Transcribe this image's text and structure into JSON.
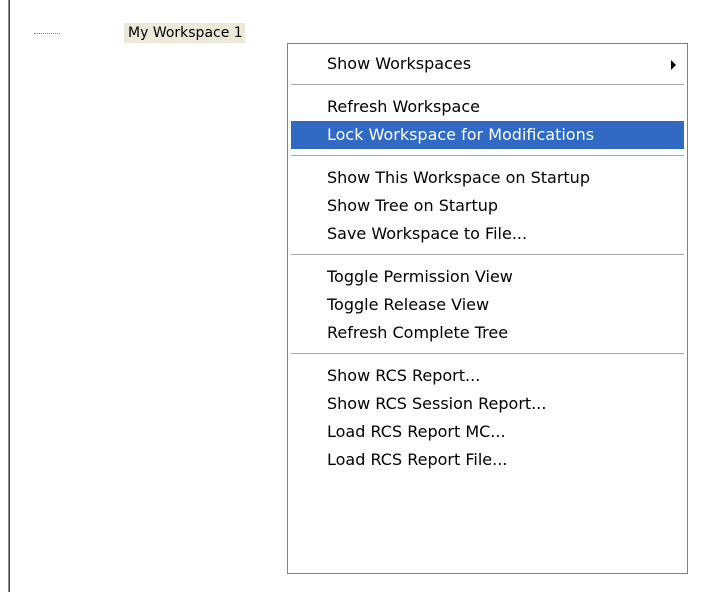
{
  "tree": {
    "workspace_label": "My Workspace 1"
  },
  "context_menu": {
    "groups": [
      [
        {
          "label": "Show Workspaces",
          "has_submenu": true
        }
      ],
      [
        {
          "label": "Refresh Workspace"
        },
        {
          "label": "Lock Workspace for Modifications",
          "highlighted": true
        }
      ],
      [
        {
          "label": "Show This Workspace on Startup"
        },
        {
          "label": "Show Tree on Startup"
        },
        {
          "label": "Save Workspace to File..."
        }
      ],
      [
        {
          "label": "Toggle Permission View"
        },
        {
          "label": "Toggle Release View"
        },
        {
          "label": "Refresh Complete Tree"
        }
      ],
      [
        {
          "label": "Show RCS Report..."
        },
        {
          "label": "Show RCS Session Report..."
        },
        {
          "label": "Load RCS Report MC..."
        },
        {
          "label": "Load RCS Report File..."
        }
      ]
    ]
  },
  "colors": {
    "highlight": "#316ac5",
    "selected_node_bg": "#ede9d9"
  }
}
